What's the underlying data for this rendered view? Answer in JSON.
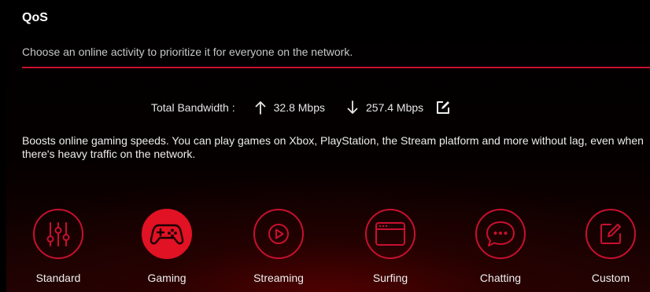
{
  "qos": {
    "title": "QoS",
    "subtitle": "Choose an online activity to prioritize it for everyone on the network.",
    "accent_color": "#c8102e",
    "active_color": "#e01224"
  },
  "bandwidth": {
    "label": "Total Bandwidth :",
    "upload": "32.8 Mbps",
    "download": "257.4 Mbps",
    "icons": {
      "upload": "arrow-up-icon",
      "download": "arrow-down-icon",
      "edit": "edit-icon"
    }
  },
  "description": "Boosts online gaming speeds. You can play games on Xbox, PlayStation, the Stream platform and more without lag, even when there's heavy traffic on the network.",
  "modes": [
    {
      "label": "Standard",
      "icon": "sliders-icon",
      "selected": false
    },
    {
      "label": "Gaming",
      "icon": "gamepad-icon",
      "selected": true
    },
    {
      "label": "Streaming",
      "icon": "play-icon",
      "selected": false
    },
    {
      "label": "Surfing",
      "icon": "browser-icon",
      "selected": false
    },
    {
      "label": "Chatting",
      "icon": "chat-bubble-icon",
      "selected": false
    },
    {
      "label": "Custom",
      "icon": "edit-icon",
      "selected": false
    }
  ]
}
